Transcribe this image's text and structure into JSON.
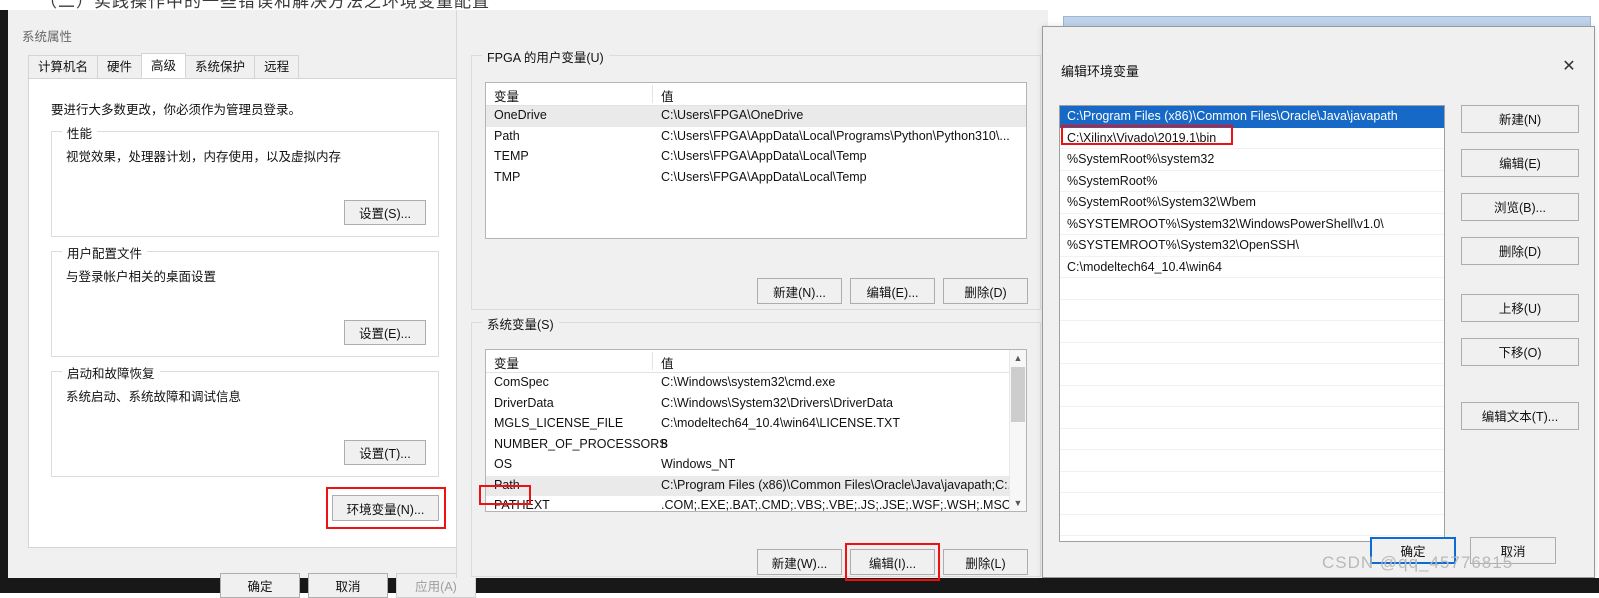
{
  "page": {
    "cutoff_top_text": "（二）实践操作中的一些错误和解决方法之环境变量配置",
    "watermark": "CSDN @qq_45776815"
  },
  "system_properties": {
    "title": "系统属性",
    "tabs": [
      {
        "label": "计算机名",
        "active": false
      },
      {
        "label": "硬件",
        "active": false
      },
      {
        "label": "高级",
        "active": true
      },
      {
        "label": "系统保护",
        "active": false
      },
      {
        "label": "远程",
        "active": false
      }
    ],
    "admin_note": "要进行大多数更改，你必须作为管理员登录。",
    "groups": [
      {
        "legend": "性能",
        "desc": "视觉效果，处理器计划，内存使用，以及虚拟内存",
        "button": "设置(S)..."
      },
      {
        "legend": "用户配置文件",
        "desc": "与登录帐户相关的桌面设置",
        "button": "设置(E)..."
      },
      {
        "legend": "启动和故障恢复",
        "desc": "系统启动、系统故障和调试信息",
        "button": "设置(T)..."
      }
    ],
    "env_button": "环境变量(N)...",
    "footer_buttons": [
      {
        "label": "确定",
        "disabled": false
      },
      {
        "label": "取消",
        "disabled": false
      },
      {
        "label": "应用(A)",
        "disabled": true
      }
    ]
  },
  "environment_variables": {
    "user_group_legend": "FPGA 的用户变量(U)",
    "system_group_legend": "系统变量(S)",
    "columns": [
      "变量",
      "值"
    ],
    "user_rows": [
      {
        "name": "OneDrive",
        "value": "C:\\Users\\FPGA\\OneDrive",
        "selected": true
      },
      {
        "name": "Path",
        "value": "C:\\Users\\FPGA\\AppData\\Local\\Programs\\Python\\Python310\\...",
        "selected": false
      },
      {
        "name": "TEMP",
        "value": "C:\\Users\\FPGA\\AppData\\Local\\Temp",
        "selected": false
      },
      {
        "name": "TMP",
        "value": "C:\\Users\\FPGA\\AppData\\Local\\Temp",
        "selected": false
      }
    ],
    "user_buttons": [
      "新建(N)...",
      "编辑(E)...",
      "删除(D)"
    ],
    "system_rows": [
      {
        "name": "ComSpec",
        "value": "C:\\Windows\\system32\\cmd.exe",
        "selected": false
      },
      {
        "name": "DriverData",
        "value": "C:\\Windows\\System32\\Drivers\\DriverData",
        "selected": false
      },
      {
        "name": "MGLS_LICENSE_FILE",
        "value": "C:\\modeltech64_10.4\\win64\\LICENSE.TXT",
        "selected": false
      },
      {
        "name": "NUMBER_OF_PROCESSORS",
        "value": "8",
        "selected": false
      },
      {
        "name": "OS",
        "value": "Windows_NT",
        "selected": false
      },
      {
        "name": "Path",
        "value": "C:\\Program Files (x86)\\Common Files\\Oracle\\Java\\javapath;C:...",
        "selected": true
      },
      {
        "name": "PATHEXT",
        "value": ".COM;.EXE;.BAT;.CMD;.VBS;.VBE;.JS;.JSE;.WSF;.WSH;.MSC",
        "selected": false
      }
    ],
    "system_buttons": [
      "新建(W)...",
      "编辑(I)...",
      "删除(L)"
    ]
  },
  "edit_env_dialog": {
    "title": "编辑环境变量",
    "close_icon": "close-icon",
    "paths": [
      {
        "value": "C:\\Program Files (x86)\\Common Files\\Oracle\\Java\\javapath",
        "selected": true
      },
      {
        "value": "C:\\Xilinx\\Vivado\\2019.1\\bin",
        "selected": false
      },
      {
        "value": "%SystemRoot%\\system32",
        "selected": false
      },
      {
        "value": "%SystemRoot%",
        "selected": false
      },
      {
        "value": "%SystemRoot%\\System32\\Wbem",
        "selected": false
      },
      {
        "value": "%SYSTEMROOT%\\System32\\WindowsPowerShell\\v1.0\\",
        "selected": false
      },
      {
        "value": "%SYSTEMROOT%\\System32\\OpenSSH\\",
        "selected": false
      },
      {
        "value": "C:\\modeltech64_10.4\\win64",
        "selected": false
      }
    ],
    "side_buttons": [
      "新建(N)",
      "编辑(E)",
      "浏览(B)...",
      "删除(D)",
      "上移(U)",
      "下移(O)",
      "编辑文本(T)..."
    ],
    "ok_label": "确定",
    "cancel_label": "取消"
  },
  "colors": {
    "selection_blue": "#1669c6",
    "highlight_red": "#ee1111",
    "focus_blue": "#0a6cd4",
    "window_gray": "#f0f0f0"
  }
}
